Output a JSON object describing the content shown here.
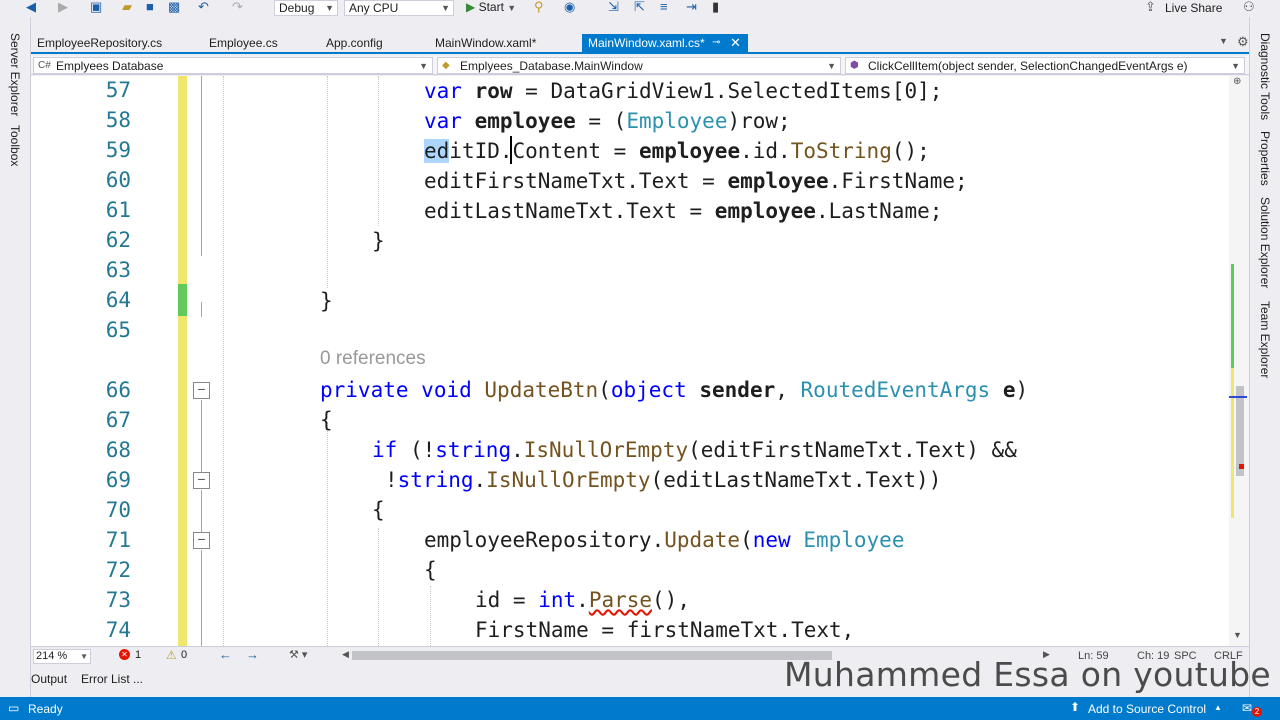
{
  "toolbar": {
    "config_label": "Debug",
    "platform_label": "Any CPU",
    "start_label": "Start",
    "live_share_label": "Live Share"
  },
  "left_rail": {
    "items": [
      "Server Explorer",
      "Toolbox"
    ]
  },
  "right_rail": {
    "items": [
      "Diagnostic Tools",
      "Properties",
      "Solution Explorer",
      "Team Explorer"
    ]
  },
  "tabs": [
    {
      "label": "EmployeeRepository.cs"
    },
    {
      "label": "Employee.cs"
    },
    {
      "label": "App.config"
    },
    {
      "label": "MainWindow.xaml*"
    },
    {
      "label": "MainWindow.xaml.cs*"
    }
  ],
  "navbar": {
    "project": "Emplyees Database",
    "class": "Emplyees_Database.MainWindow",
    "member": "ClickCellItem(object sender, SelectionChangedEventArgs e)"
  },
  "line_numbers": [
    "57",
    "58",
    "59",
    "60",
    "61",
    "62",
    "63",
    "64",
    "65",
    "66",
    "67",
    "68",
    "69",
    "70",
    "71",
    "72",
    "73",
    "74"
  ],
  "codelens": "0 references",
  "bottom": {
    "zoom": "214 %",
    "errors": "1",
    "warnings": "0",
    "ln": "Ln: 59",
    "ch": "Ch: 19",
    "spc": "SPC",
    "crlf": "CRLF"
  },
  "panel_tabs": [
    "Output",
    "Error List ..."
  ],
  "status": {
    "ready": "Ready",
    "source_control": "Add to Source Control",
    "notifications": "2"
  },
  "watermark": "Muhammed Essa on youtube"
}
